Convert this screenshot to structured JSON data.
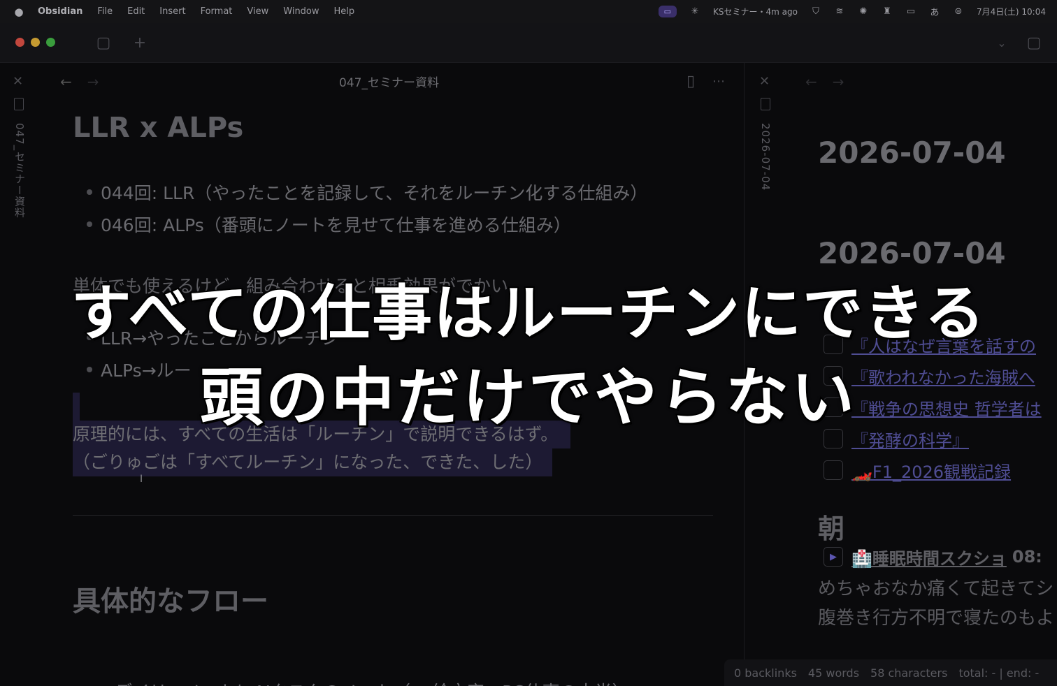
{
  "menubar": {
    "items": [
      "Obsidian",
      "File",
      "Edit",
      "Insert",
      "Format",
      "View",
      "Window",
      "Help"
    ],
    "status_text": "KSセミナー・4m ago",
    "datetime": "7月4日(土) 10:04",
    "input_mode": "あ"
  },
  "left_pane": {
    "title": "047_セミナー資料",
    "vertical_tab_label": "047_セミナー資料",
    "heading": "LLR x ALPs",
    "bullets": [
      "044回: LLR（やったことを記録して、それをルーチン化する仕組み）",
      "046回: ALPs（番頭にノートを見せて仕事を進める仕組み）"
    ],
    "bullets2": [
      "LLR→やったことからルーチン",
      "ALPs→ルー"
    ],
    "partial_line": "単体でも使えるけど、組み合わせると相乗効果がでかい",
    "highlighted": [
      "原理的には、すべての生活は「ルーチン」で説明できるはず。",
      "（ごりゅごは「すべてルーチン」になった、できた、した）"
    ],
    "heading2": "具体的なフロー",
    "bullets3": [
      "デイリーノートにAIタスクのノート（⛺絵文字。PC仕事の大半）"
    ]
  },
  "right_pane": {
    "vertical_tab_label": "2026-07-04",
    "date1": "2026-07-04",
    "date2": "2026-07-04",
    "tasks": [
      "『人はなぜ言葉を話すの",
      "『歌われなかった海賊へ",
      "『戦争の思想史 哲学者は",
      "『発酵の科学』",
      "🏎️F1_2026観戦記録"
    ],
    "morning_heading": "朝",
    "sleep_link": "🏥睡眠時間スクショ",
    "sleep_time": "08:",
    "line1": "めちゃおなか痛くて起きてシ",
    "line2": "腹巻き行方不明で寝たのもよ"
  },
  "statusbar": {
    "backlinks": "0 backlinks",
    "words": "45 words",
    "characters": "58 characters",
    "extra": "total: - | end: -"
  },
  "overlay": {
    "line1": "すべての仕事はルーチンにできる",
    "line2": "頭の中だけでやらない"
  }
}
